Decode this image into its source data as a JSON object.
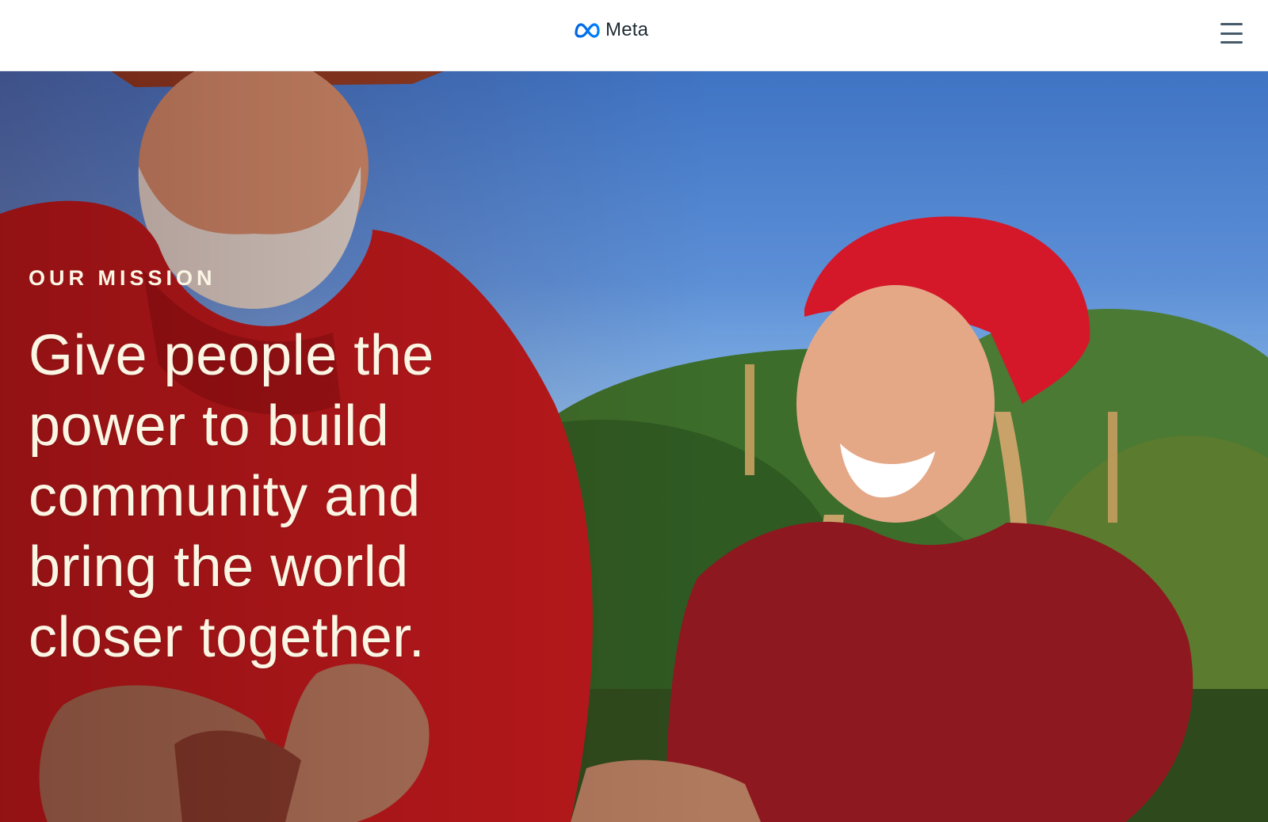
{
  "header": {
    "brand_name": "Meta",
    "logo_icon": "meta-infinity-icon",
    "menu_icon": "hamburger-menu-icon",
    "brand_color": "#0668e1"
  },
  "hero": {
    "eyebrow": "OUR MISSION",
    "headline_lines": [
      "Give people the",
      "power to build",
      "community and",
      "bring the world",
      "closer together."
    ],
    "text_color": "#fbf5e4"
  }
}
